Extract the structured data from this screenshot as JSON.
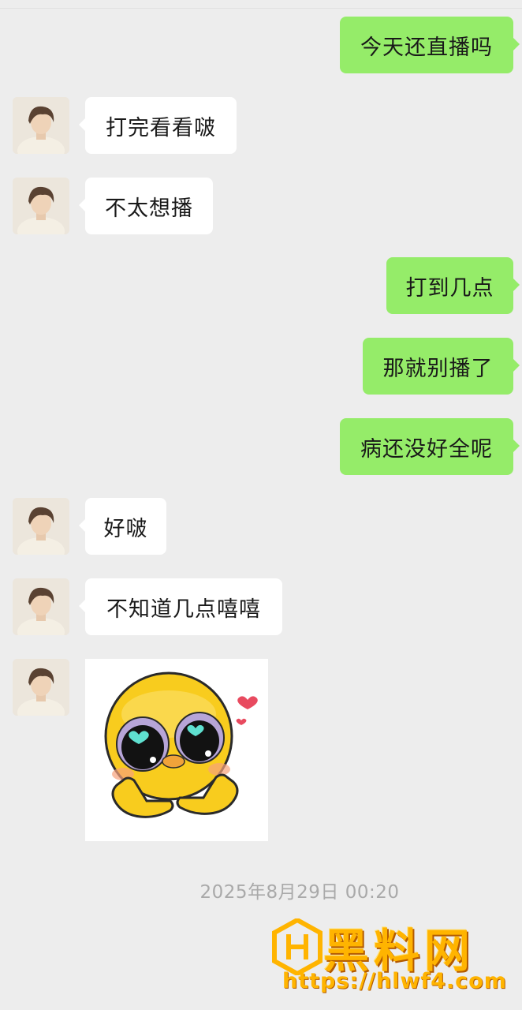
{
  "messages": [
    {
      "side": "out",
      "text": "今天还直播吗"
    },
    {
      "side": "in",
      "text": "打完看看啵"
    },
    {
      "side": "in",
      "text": "不太想播"
    },
    {
      "side": "out",
      "text": "打到几点"
    },
    {
      "side": "out",
      "text": "那就别播了"
    },
    {
      "side": "out",
      "text": "病还没好全呢"
    },
    {
      "side": "in",
      "text": "好啵"
    },
    {
      "side": "in",
      "text": "不知道几点嘻嘻"
    },
    {
      "side": "in",
      "type": "sticker",
      "sticker": "cute-blushing-emoji-heart-eyes-sticker"
    }
  ],
  "timestamp": "2025年8月29日 00:20",
  "watermark": {
    "title": "黑料网",
    "url": "https://hlwf4.com"
  },
  "colors": {
    "background": "#ededed",
    "out_bubble": "#95ec69",
    "in_bubble": "#ffffff",
    "timestamp": "#a9a9a9"
  }
}
